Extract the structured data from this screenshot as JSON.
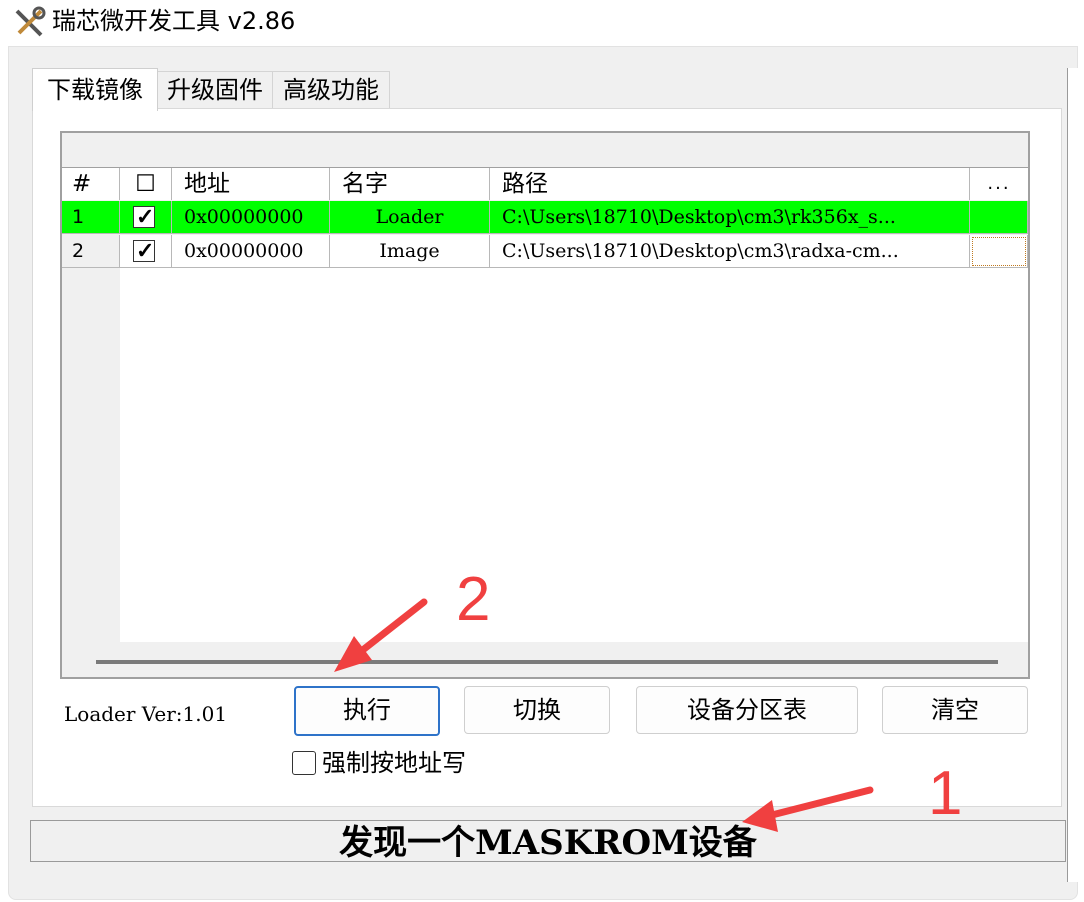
{
  "window": {
    "title": "瑞芯微开发工具 v2.86"
  },
  "tabs": [
    {
      "label": "下载镜像",
      "active": true
    },
    {
      "label": "升级固件",
      "active": false
    },
    {
      "label": "高级功能",
      "active": false
    }
  ],
  "grid": {
    "columns": {
      "num": "#",
      "check": "☐",
      "address": "地址",
      "name": "名字",
      "path": "路径",
      "more": "..."
    },
    "rows": [
      {
        "num": "1",
        "checked": true,
        "address": "0x00000000",
        "name": "Loader",
        "path": "C:\\Users\\18710\\Desktop\\cm3\\rk356x_s...",
        "highlighted": true
      },
      {
        "num": "2",
        "checked": true,
        "address": "0x00000000",
        "name": "Image",
        "path": "C:\\Users\\18710\\Desktop\\cm3\\radxa-cm...",
        "highlighted": false
      }
    ],
    "highlight_color": "#00ff00"
  },
  "loader_version": "Loader Ver:1.01",
  "buttons": {
    "execute": "执行",
    "switch": "切换",
    "partition_table": "设备分区表",
    "clear": "清空"
  },
  "force_write": {
    "label": "强制按地址写",
    "checked": false
  },
  "status": {
    "text": "发现一个MASKROM设备"
  },
  "annotations": {
    "marker_1": "1",
    "marker_2": "2",
    "color": "#f04040"
  }
}
